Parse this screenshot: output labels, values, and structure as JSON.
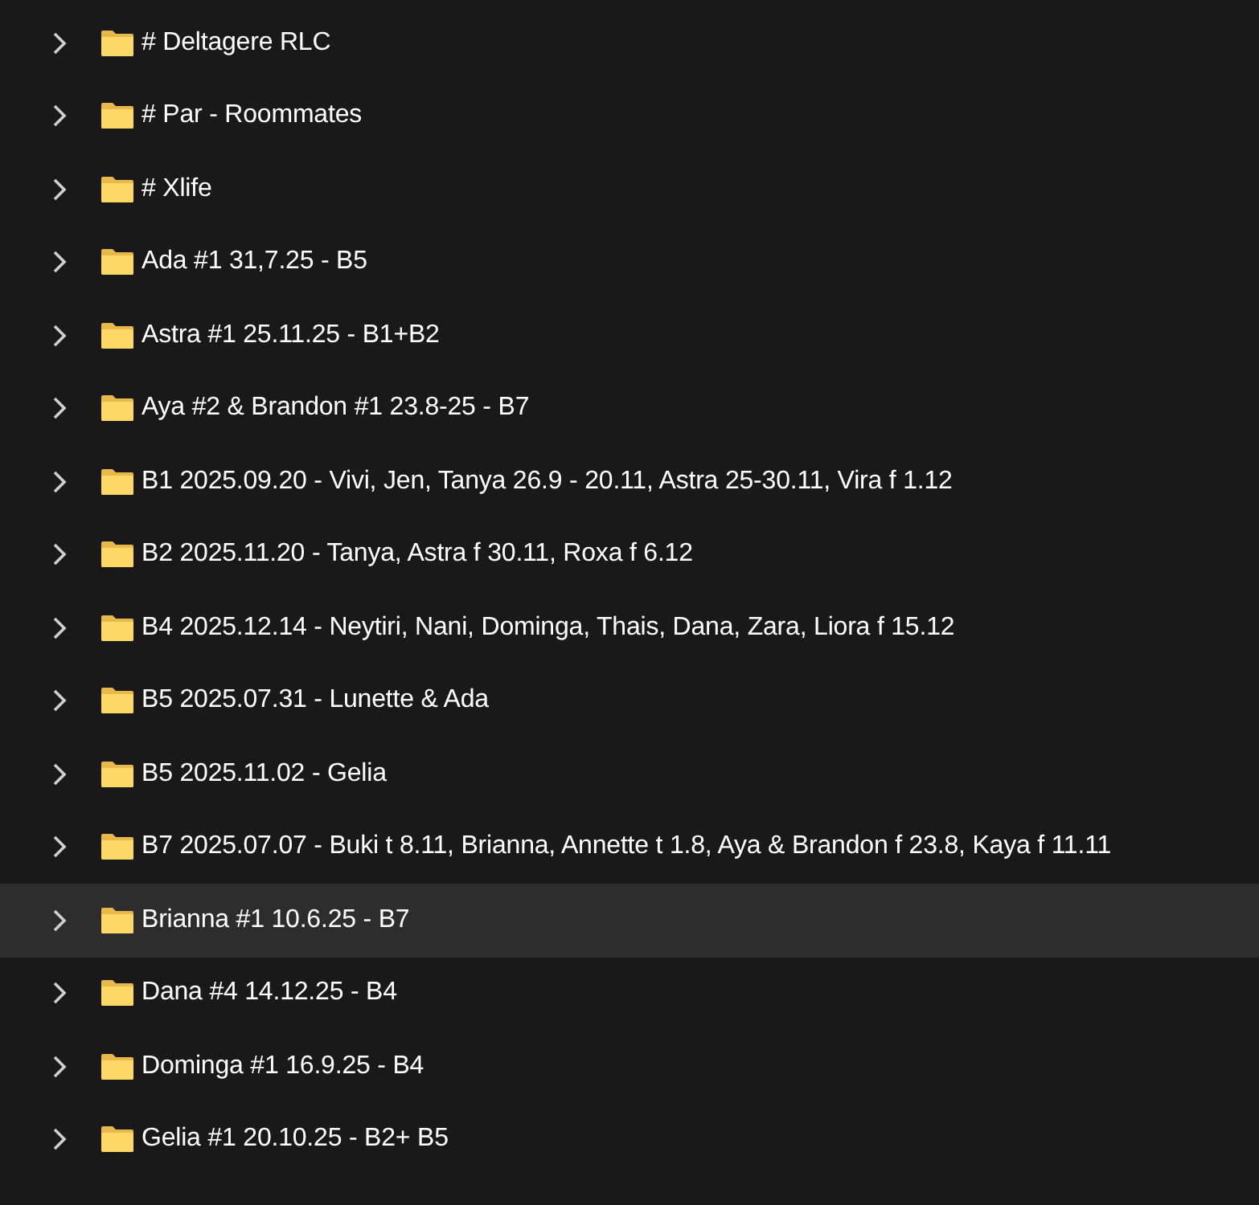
{
  "folders": [
    {
      "name": "# Deltagere RLC",
      "expanded": false,
      "selected": false
    },
    {
      "name": "# Par - Roommates",
      "expanded": false,
      "selected": false
    },
    {
      "name": "# Xlife",
      "expanded": false,
      "selected": false
    },
    {
      "name": "Ada #1 31,7.25 - B5",
      "expanded": false,
      "selected": false
    },
    {
      "name": "Astra #1 25.11.25 - B1+B2",
      "expanded": false,
      "selected": false
    },
    {
      "name": "Aya #2 & Brandon #1 23.8-25 - B7",
      "expanded": false,
      "selected": false
    },
    {
      "name": "B1 2025.09.20 - Vivi, Jen, Tanya 26.9 - 20.11, Astra 25-30.11, Vira f 1.12",
      "expanded": false,
      "selected": false
    },
    {
      "name": "B2 2025.11.20 - Tanya, Astra f 30.11, Roxa f 6.12",
      "expanded": false,
      "selected": false
    },
    {
      "name": "B4 2025.12.14 - Neytiri, Nani, Dominga, Thais, Dana, Zara, Liora f 15.12",
      "expanded": false,
      "selected": false
    },
    {
      "name": "B5 2025.07.31 - Lunette & Ada",
      "expanded": false,
      "selected": false
    },
    {
      "name": "B5 2025.11.02 - Gelia",
      "expanded": false,
      "selected": false
    },
    {
      "name": "B7 2025.07.07 - Buki t 8.11, Brianna, Annette t 1.8, Aya & Brandon f 23.8, Kaya f 11.11",
      "expanded": false,
      "selected": false
    },
    {
      "name": "Brianna #1 10.6.25 - B7",
      "expanded": false,
      "selected": true
    },
    {
      "name": "Dana #4 14.12.25 - B4",
      "expanded": false,
      "selected": false
    },
    {
      "name": "Dominga #1 16.9.25 - B4",
      "expanded": false,
      "selected": false
    },
    {
      "name": "Gelia #1 20.10.25 - B2+ B5",
      "expanded": false,
      "selected": false
    }
  ]
}
